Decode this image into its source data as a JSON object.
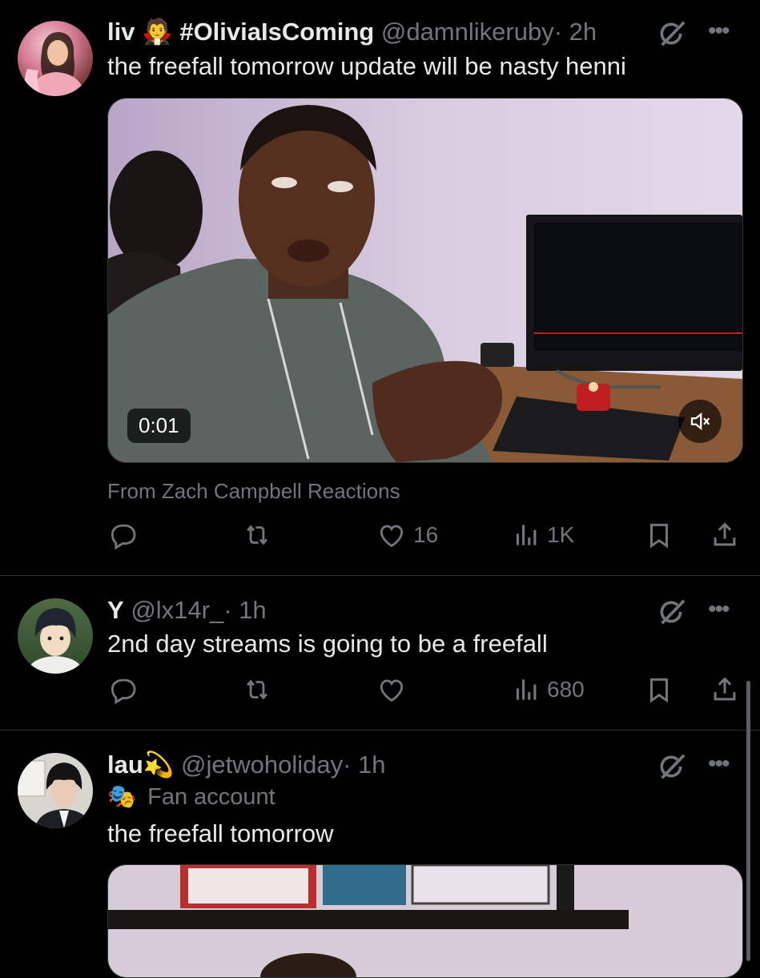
{
  "tweets": [
    {
      "name": "liv",
      "name_emoji": "🧛",
      "name_suffix": "#OliviaIsComing",
      "handle": "@damnlikeruby",
      "time": "· 2h",
      "text": "the freefall tomorrow update will be nasty henni",
      "video": {
        "time": "0:01",
        "source": "From Zach Campbell Reactions"
      },
      "replies": "",
      "reposts": "",
      "likes": "16",
      "views": "1K"
    },
    {
      "name": "Y",
      "handle": "@lx14r_",
      "time": "· 1h",
      "text": "2nd day streams is going to be a freefall",
      "replies": "",
      "reposts": "",
      "likes": "",
      "views": "680"
    },
    {
      "name": "lau",
      "name_emoji": "💫",
      "handle": "@jetwoholiday",
      "time": "· 1h",
      "label_emoji": "🎭",
      "label": "Fan account",
      "text": "the freefall tomorrow"
    }
  ],
  "icons": {
    "reply": "reply-icon",
    "repost": "repost-icon",
    "like": "heart-icon",
    "views": "views-icon",
    "bookmark": "bookmark-icon",
    "share": "share-icon",
    "grok": "grok-icon",
    "more": "more-icon",
    "mute": "mute-icon"
  },
  "colors": {
    "background": "#000000",
    "text": "#e7e9ea",
    "secondary": "#71767b",
    "divider": "#2f3336"
  }
}
